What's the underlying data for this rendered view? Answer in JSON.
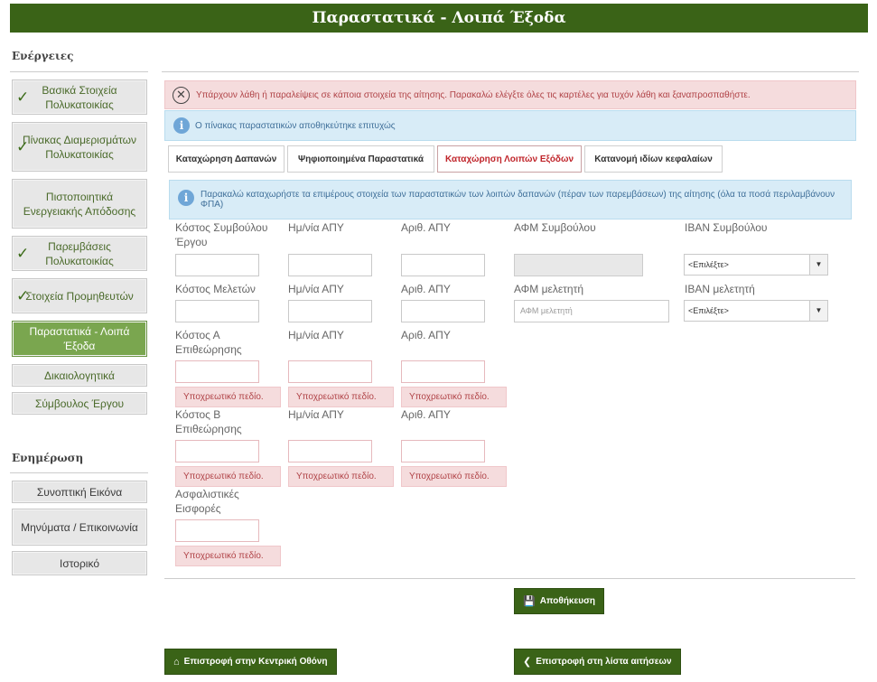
{
  "header": {
    "title": "Παραστατικά - Λοιπά Έξοδα"
  },
  "sidebar": {
    "actions_title": "Ενέργειες",
    "actions": [
      {
        "label": "Βασικά Στοιχεία Πολυκατοικίας",
        "checked": true
      },
      {
        "label": "Πίνακας Διαμερισμάτων Πολυκατοικίας",
        "checked": true
      },
      {
        "label": "Πιστοποιητικά Ενεργειακής Απόδοσης",
        "checked": false
      },
      {
        "label": "Παρεμβάσεις Πολυκατοικίας",
        "checked": true
      },
      {
        "label": "Στοιχεία Προμηθευτών",
        "checked": true
      },
      {
        "label": "Παραστατικά - Λοιπά Έξοδα",
        "checked": false,
        "active": true
      },
      {
        "label": "Δικαιολογητικά",
        "checked": false
      },
      {
        "label": "Σύμβουλος Έργου",
        "checked": false
      }
    ],
    "update_title": "Ενημέρωση",
    "updates": [
      {
        "label": "Συνοπτική Εικόνα"
      },
      {
        "label": "Μηνύματα / Επικοινωνία"
      },
      {
        "label": "Ιστορικό"
      }
    ]
  },
  "alerts": {
    "error": "Υπάρχουν λάθη ή παραλείψεις σε κάποια στοιχεία της αίτησης. Παρακαλώ ελέγξτε όλες τις καρτέλες για τυχόν λάθη και ξαναπροσπαθήστε.",
    "success": "Ο πίνακας παραστατικών αποθηκεύτηκε επιτυχώς",
    "info": "Παρακαλώ καταχωρήστε τα επιμέρους στοιχεία των παραστατικών των λοιπών δαπανών (πέραν των παρεμβάσεων) της αίτησης (όλα τα ποσά περιλαμβάνουν ΦΠΑ)"
  },
  "tabs": [
    {
      "label": "Καταχώρηση Δαπανών"
    },
    {
      "label": "Ψηφιοποιημένα Παραστατικά"
    },
    {
      "label": "Καταχώρηση Λοιπών Εξόδων",
      "active": true
    },
    {
      "label": "Κατανομή ιδίων κεφαλαίων"
    }
  ],
  "form": {
    "row1": {
      "cost": "Κόστος Συμβούλου Έργου",
      "date": "Ημ/νία ΑΠΥ",
      "num": "Αριθ. ΑΠΥ",
      "afm": "ΑΦΜ Συμβούλου",
      "iban": "IBAN Συμβούλου",
      "iban_value": "<Επιλέξτε>"
    },
    "row2": {
      "cost": "Κόστος Μελετών",
      "date": "Ημ/νία ΑΠΥ",
      "num": "Αριθ. ΑΠΥ",
      "afm": "ΑΦΜ μελετητή",
      "afm_placeholder": "ΑΦΜ μελετητή",
      "iban": "IBAN μελετητή",
      "iban_value": "<Επιλέξτε>"
    },
    "row3": {
      "cost": "Κόστος Α Επιθεώρησης",
      "date": "Ημ/νία ΑΠΥ",
      "num": "Αριθ. ΑΠΥ"
    },
    "row4": {
      "cost": "Κόστος Β Επιθεώρησης",
      "date": "Ημ/νία ΑΠΥ",
      "num": "Αριθ. ΑΠΥ"
    },
    "row5": {
      "cost": "Ασφαλιστικές Εισφορές"
    },
    "required_msg": "Υποχρεωτικό πεδίο."
  },
  "buttons": {
    "save": "Αποθήκευση",
    "home": "Επιστροφή στην Κεντρική Οθόνη",
    "back_list": "Επιστροφή στη λίστα αιτήσεων"
  }
}
